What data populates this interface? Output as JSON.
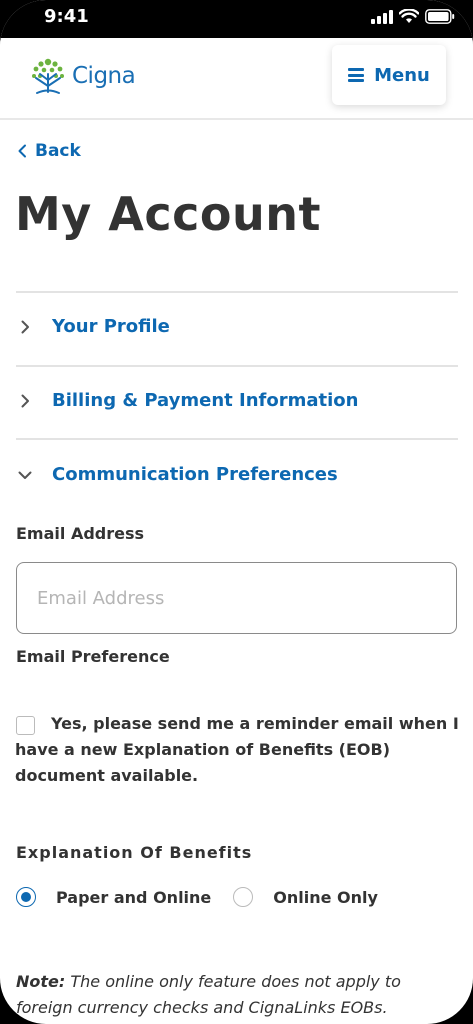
{
  "status_bar": {
    "time": "9:41"
  },
  "header": {
    "logo_text": "Cigna",
    "menu_label": "Menu"
  },
  "nav": {
    "back_label": "Back"
  },
  "page": {
    "title": "My Account"
  },
  "accordion": {
    "items": [
      {
        "label": "Your Profile",
        "expanded": false
      },
      {
        "label": "Billing & Payment Information",
        "expanded": false
      },
      {
        "label": "Communication Preferences",
        "expanded": true
      }
    ]
  },
  "communication": {
    "email_label": "Email Address",
    "email_value": "",
    "email_placeholder": "Email Address",
    "email_pref_label": "Email Preference",
    "reminder_text": "Yes, please send me a reminder email when I have a new Explanation of Benefits (EOB) document available.",
    "reminder_checked": false,
    "eob_title": "Explanation Of Benefits",
    "eob_options": [
      {
        "label": "Paper and Online",
        "selected": true
      },
      {
        "label": "Online Only",
        "selected": false
      }
    ],
    "note_label": "Note:",
    "note_text": " The online only feature does not apply to foreign currency checks and CignaLinks EOBs."
  },
  "colors": {
    "brand_blue": "#0d68b1",
    "logo_green": "#6cb33f",
    "text_dark": "#333333"
  }
}
